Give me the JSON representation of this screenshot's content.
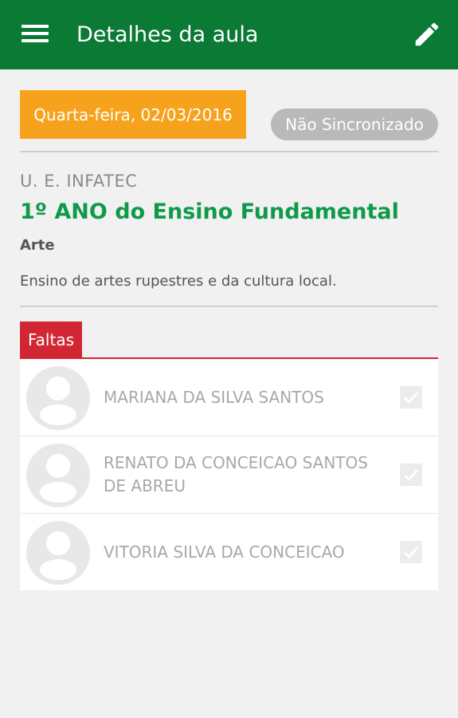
{
  "appbar": {
    "title": "Detalhes da aula",
    "menu_icon": "hamburger-menu-icon",
    "edit_icon": "pencil-icon",
    "background_color": "#0a7a35"
  },
  "lesson": {
    "date": "Quarta-feira, 02/03/2016",
    "sync_status": "Não Sincronizado",
    "school": "U. E. INFATEC",
    "class_name": "1º ANO do Ensino Fundamental",
    "subject": "Arte",
    "description": "Ensino de artes rupestres e da cultura local."
  },
  "tabs": {
    "absences_label": "Faltas"
  },
  "students": [
    {
      "name": "MARIANA DA SILVA SANTOS",
      "checked": true,
      "avatar_icon": "person-placeholder-icon"
    },
    {
      "name": "RENATO DA CONCEICAO SANTOS DE ABREU",
      "checked": true,
      "avatar_icon": "person-placeholder-icon"
    },
    {
      "name": "VITORIA SILVA DA CONCEICAO",
      "checked": true,
      "avatar_icon": "person-placeholder-icon"
    }
  ],
  "colors": {
    "primary": "#0a7a35",
    "accent_green_text": "#0f9a4a",
    "date_badge": "#f7a21c",
    "sync_badge": "#b9b9b9",
    "absences_tab": "#d32634"
  }
}
